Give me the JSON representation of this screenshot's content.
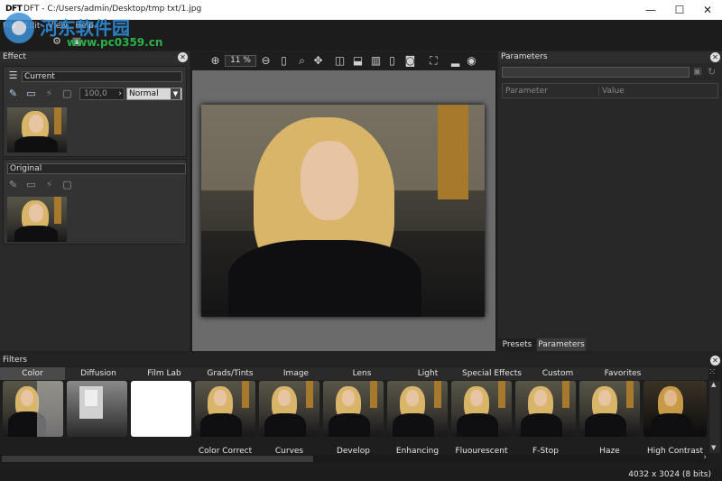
{
  "window": {
    "logo": "DFT",
    "title": "DFT - C:/Users/admin/Desktop/tmp txt/1.jpg",
    "minimize": "—",
    "maximize": "☐",
    "close": "✕"
  },
  "watermark": {
    "cn_text": "河东软件园",
    "url": "www.pc0359.cn"
  },
  "menu": [
    "File",
    "Edit",
    "View",
    "Help"
  ],
  "effect_panel": {
    "title": "Effect",
    "current_label": "Current",
    "original_label": "Original",
    "opacity": "100,0",
    "blend_mode": "Normal"
  },
  "canvas": {
    "zoom": "11 %"
  },
  "parameters_panel": {
    "title": "Parameters",
    "columns": [
      "Parameter",
      "Value"
    ],
    "tabs": [
      "Presets",
      "Parameters"
    ]
  },
  "filters_panel": {
    "title": "Filters",
    "tabs": [
      "Color",
      "Diffusion",
      "Film Lab",
      "Grads/Tints",
      "Image",
      "Lens",
      "Light",
      "Special Effects",
      "Custom",
      "Favorites"
    ],
    "thumbs": [
      "",
      "",
      "",
      "Color Correct",
      "Curves",
      "Develop",
      "Enhancing",
      "Fluourescent",
      "F-Stop",
      "Haze",
      "High Contrast"
    ]
  },
  "status": {
    "dimensions": "4032 x 3024 (8 bits)"
  },
  "colors": {
    "bg": "#222222",
    "panel": "#2a2a2a",
    "canvas": "#6b6b6b",
    "accent": "#3c8fd6"
  }
}
